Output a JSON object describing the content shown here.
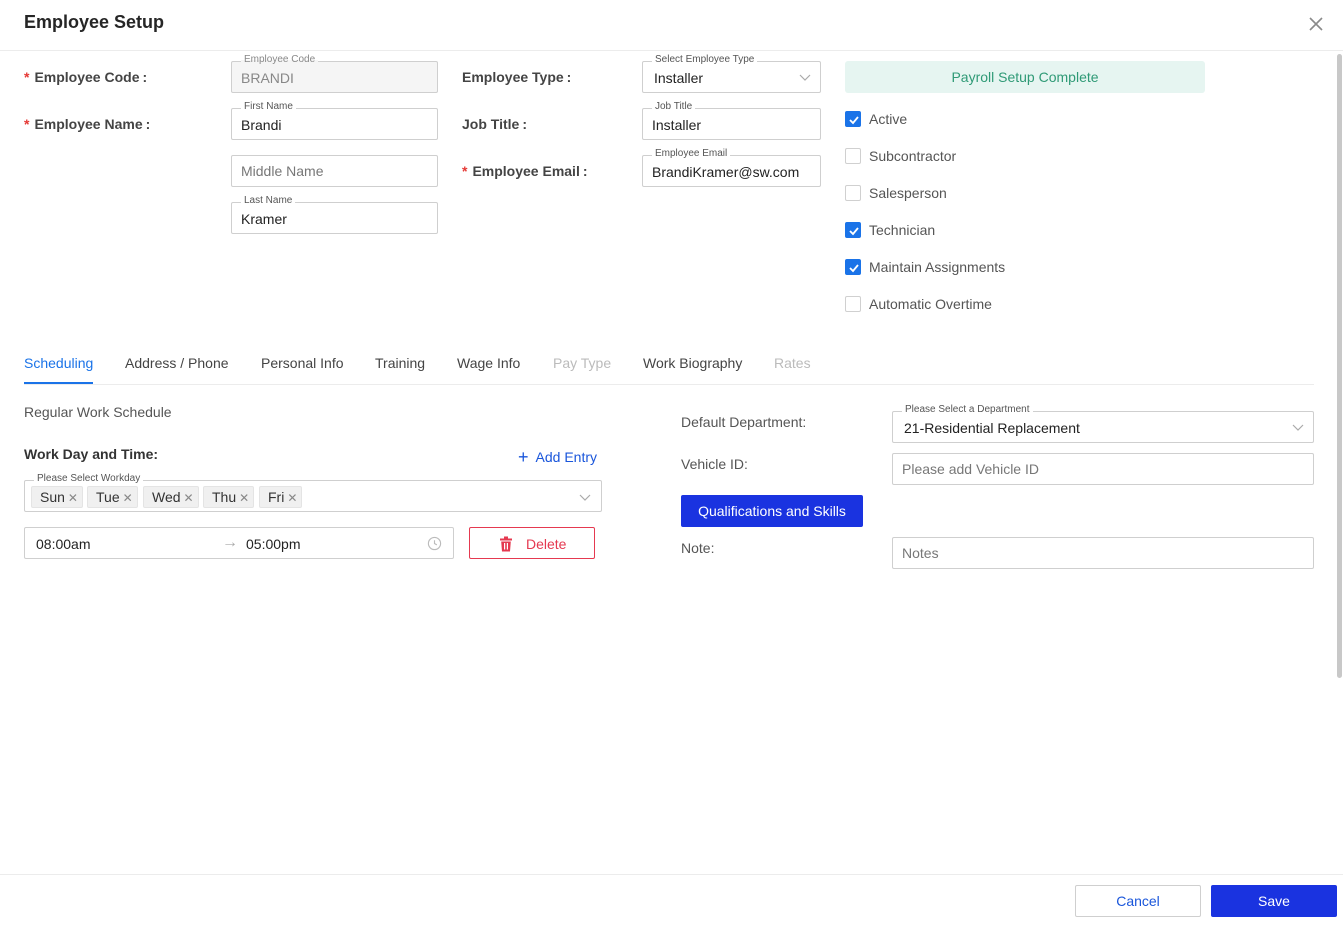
{
  "dialog": {
    "title": "Employee Setup"
  },
  "form": {
    "employee_code": {
      "label": "Employee Code",
      "colon": ":",
      "float_label": "Employee Code",
      "value": "BRANDI"
    },
    "employee_name": {
      "label": "Employee Name",
      "colon": ":"
    },
    "first_name": {
      "float_label": "First Name",
      "value": "Brandi"
    },
    "middle_name": {
      "placeholder": "Middle Name"
    },
    "last_name": {
      "float_label": "Last Name",
      "value": "Kramer"
    },
    "employee_type": {
      "label": "Employee Type",
      "colon": ":",
      "float_label": "Select Employee Type",
      "value": "Installer"
    },
    "job_title": {
      "label": "Job Title",
      "colon": ":",
      "float_label": "Job Title",
      "value": "Installer"
    },
    "employee_email": {
      "label": "Employee Email",
      "colon": ":",
      "float_label": "Employee Email",
      "value": "BrandiKramer@sw.com"
    },
    "required_mark": "*"
  },
  "payroll_badge": "Payroll Setup Complete",
  "checkboxes": [
    {
      "label": "Active",
      "checked": true
    },
    {
      "label": "Subcontractor",
      "checked": false
    },
    {
      "label": "Salesperson",
      "checked": false
    },
    {
      "label": "Technician",
      "checked": true
    },
    {
      "label": "Maintain Assignments",
      "checked": true
    },
    {
      "label": "Automatic Overtime",
      "checked": false
    }
  ],
  "tabs": [
    {
      "label": "Scheduling",
      "state": "active"
    },
    {
      "label": "Address / Phone",
      "state": "normal"
    },
    {
      "label": "Personal Info",
      "state": "normal"
    },
    {
      "label": "Training",
      "state": "normal"
    },
    {
      "label": "Wage Info",
      "state": "normal"
    },
    {
      "label": "Pay Type",
      "state": "disabled"
    },
    {
      "label": "Work Biography",
      "state": "normal"
    },
    {
      "label": "Rates",
      "state": "disabled"
    }
  ],
  "scheduling": {
    "subtitle": "Regular Work Schedule",
    "work_day_label": "Work Day and Time:",
    "add_entry": "Add Entry",
    "workday_float_label": "Please Select Workday",
    "workdays": [
      "Sun",
      "Tue",
      "Wed",
      "Thu",
      "Fri"
    ],
    "start_time": "08:00am",
    "range_arrow": "→",
    "end_time": "05:00pm",
    "delete_label": "Delete"
  },
  "right_panel": {
    "default_department_label": "Default Department:",
    "department_float_label": "Please Select a Department",
    "department_value": "21-Residential Replacement",
    "vehicle_label": "Vehicle ID:",
    "vehicle_placeholder": "Please add Vehicle ID",
    "qualifications_button": "Qualifications and Skills",
    "note_label": "Note:",
    "note_placeholder": "Notes"
  },
  "footer": {
    "cancel": "Cancel",
    "save": "Save"
  },
  "colors": {
    "primary": "#1a33e0",
    "link": "#1a56db",
    "checkbox": "#1a73e8",
    "required": "#e53935",
    "danger": "#e53950",
    "success_text": "#2f9a76",
    "success_bg": "#e6f5f1"
  }
}
